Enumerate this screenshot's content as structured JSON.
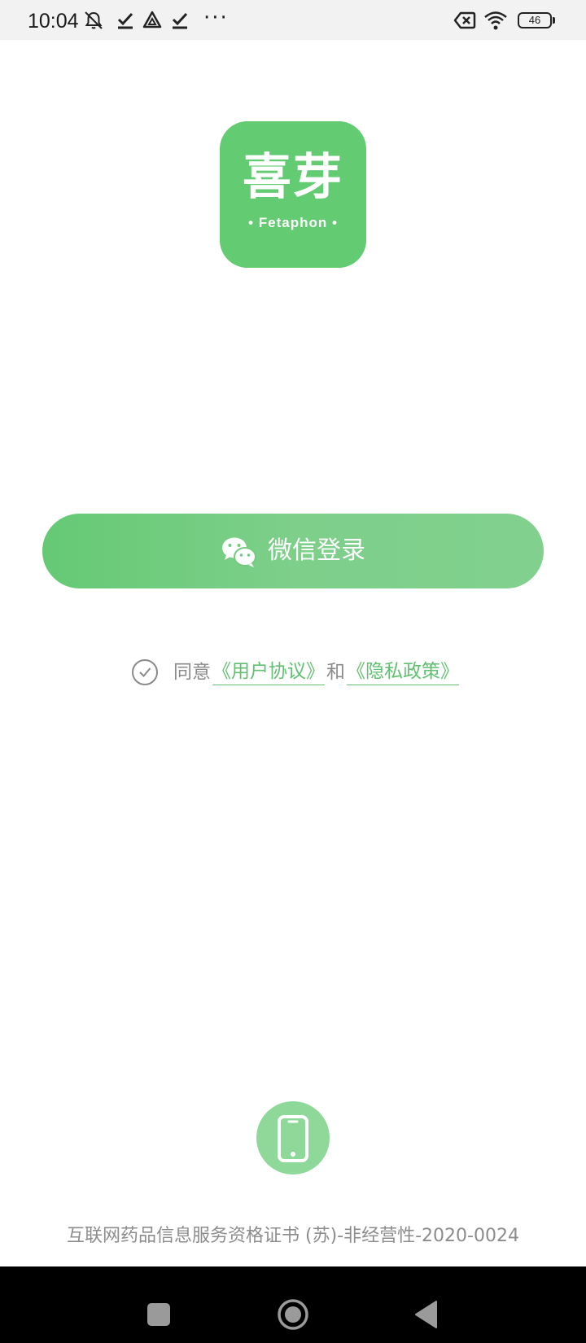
{
  "status_bar": {
    "time": "10:04",
    "more": "···",
    "battery_level": "46",
    "icons": [
      "mute-icon",
      "check-icon",
      "drive-icon",
      "check-icon",
      "sim-missing-icon",
      "wifi-icon",
      "battery-icon"
    ]
  },
  "logo": {
    "name_cn": "喜芽",
    "name_en": "• Fetaphon •"
  },
  "login": {
    "wechat_label": "微信登录"
  },
  "agreement": {
    "prefix": "同意",
    "user_agreement": "《用户协议》",
    "conjunction": "和",
    "privacy_policy": "《隐私政策》"
  },
  "footer": {
    "license": "互联网药品信息服务资格证书 (苏)-非经营性-2020-0024"
  },
  "colors": {
    "brand_green": "#63cb72",
    "link_green": "#63c072",
    "phone_button": "#8ed99a",
    "muted_text": "#8c8c8c"
  }
}
